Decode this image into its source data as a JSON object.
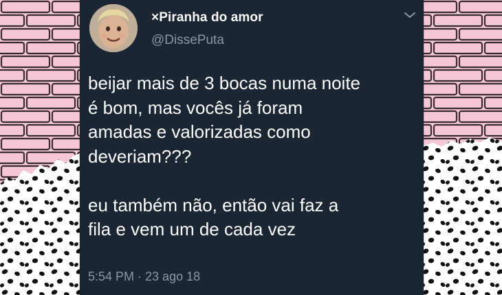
{
  "tweet": {
    "display_name": "×Piranha do amor",
    "handle": "@DissePuta",
    "text_lines": [
      "beijar mais de 3 bocas numa noite",
      "é bom, mas vocês já foram",
      "amadas e valorizadas como",
      "deveriam???",
      "eu também não, então vai faz a",
      "fila e vem um de cada vez"
    ],
    "timestamp": "5:54 PM · 23 ago 18",
    "avatar_icon": "doll-avatar-icon",
    "menu_icon": "chevron-down-icon"
  },
  "colors": {
    "card_background": "#1b2634",
    "name_text": "#ffffff",
    "muted_text": "#8a97a6",
    "brick_pink": "#f4c6d6",
    "mortar": "#3a2b30",
    "polka_background": "#ffffff",
    "polka_dot": "#111111"
  }
}
